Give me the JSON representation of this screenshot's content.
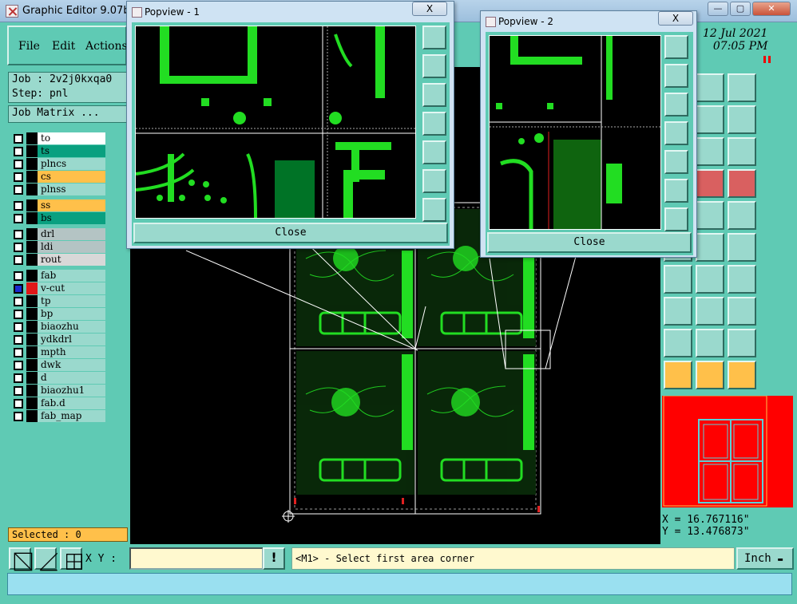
{
  "window": {
    "title": "Graphic Editor 9.07b2"
  },
  "menu": {
    "file": "File",
    "edit": "Edit",
    "actions": "Actions"
  },
  "job": {
    "job_line": "Job : 2v2j0kxqa0",
    "step_line": "Step: pnl",
    "matrix_button": "Job Matrix ..."
  },
  "layers": [
    {
      "name": "to",
      "color": "#ffffff",
      "swatch": "#000000"
    },
    {
      "name": "ts",
      "color": "#0aa080",
      "swatch": "#000000"
    },
    {
      "name": "plncs",
      "color": "#9ad9cd",
      "swatch": "#000000"
    },
    {
      "name": "cs",
      "color": "#ffc04a",
      "swatch": "#000000"
    },
    {
      "name": "plnss",
      "color": "#9ad9cd",
      "swatch": "#000000"
    },
    {
      "name": "ss",
      "color": "#ffc04a",
      "swatch": "#000000"
    },
    {
      "name": "bs",
      "color": "#0aa080",
      "swatch": "#000000"
    },
    {
      "name": "drl",
      "color": "#b4c4c4",
      "swatch": "#000000"
    },
    {
      "name": "ldi",
      "color": "#b4c4c4",
      "swatch": "#000000"
    },
    {
      "name": "rout",
      "color": "#d8d8d8",
      "swatch": "#000000"
    },
    {
      "name": "fab",
      "color": "#9ad9cd",
      "swatch": "#000000"
    },
    {
      "name": "v-cut",
      "color": "#9ad9cd",
      "swatch": "#e01818",
      "checked": true
    },
    {
      "name": "tp",
      "color": "#9ad9cd",
      "swatch": "#000000"
    },
    {
      "name": "bp",
      "color": "#9ad9cd",
      "swatch": "#000000"
    },
    {
      "name": "biaozhu",
      "color": "#9ad9cd",
      "swatch": "#000000"
    },
    {
      "name": "ydkdrl",
      "color": "#9ad9cd",
      "swatch": "#000000"
    },
    {
      "name": "mpth",
      "color": "#9ad9cd",
      "swatch": "#000000"
    },
    {
      "name": "dwk",
      "color": "#9ad9cd",
      "swatch": "#000000"
    },
    {
      "name": "d",
      "color": "#9ad9cd",
      "swatch": "#000000"
    },
    {
      "name": "biaozhu1",
      "color": "#9ad9cd",
      "swatch": "#000000"
    },
    {
      "name": "fab.d",
      "color": "#9ad9cd",
      "swatch": "#000000"
    },
    {
      "name": "fab_map",
      "color": "#9ad9cd",
      "swatch": "#000000"
    }
  ],
  "selected": "Selected : 0",
  "datetime": {
    "date": "12 Jul 2021",
    "time": "07:05 PM"
  },
  "coords": {
    "x": "X = 16.767116\"",
    "y": "Y = 13.476873\""
  },
  "bottom": {
    "xy_label": "X Y :",
    "xy_value": "",
    "prompt": "<M1> - Select first area corner",
    "unit": "Inch"
  },
  "popview1": {
    "title": "Popview - 1",
    "close": "Close",
    "close_x": "X"
  },
  "popview2": {
    "title": "Popview - 2",
    "close": "Close",
    "close_x": "X"
  },
  "icons": [
    "zoom-fit-icon",
    "zoom-home-icon",
    "zoom-xy-icon",
    "mirror-icon",
    "snap-icon",
    "rotate-12-icon",
    "help-icon"
  ]
}
